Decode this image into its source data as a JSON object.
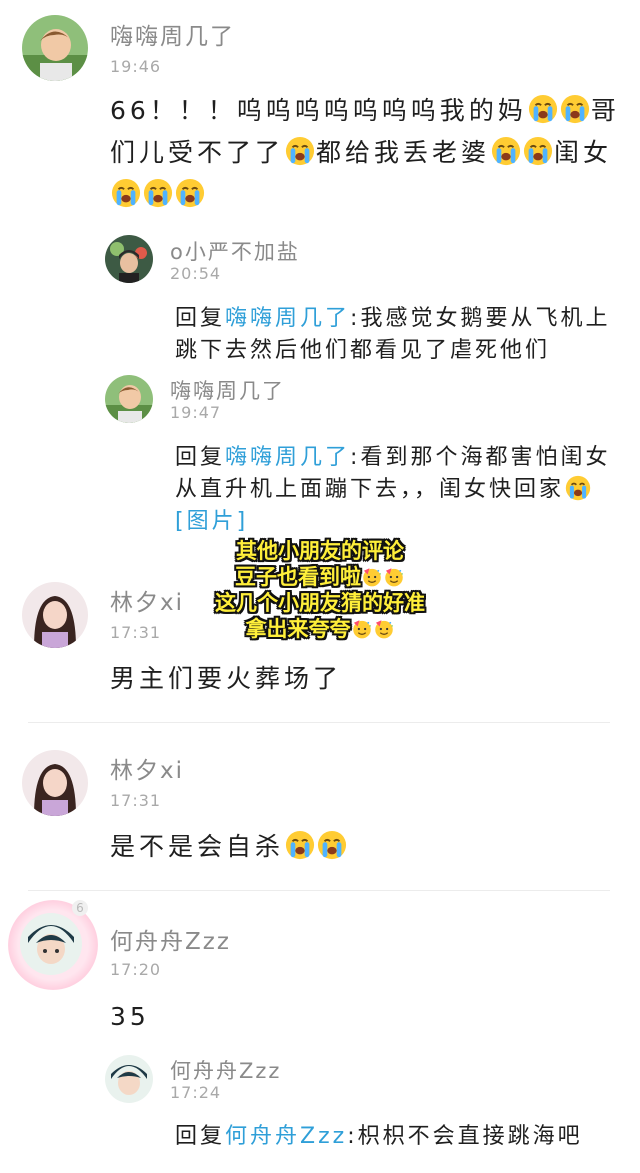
{
  "comments": [
    {
      "user": "嗨嗨周几了",
      "time": "19:46",
      "text_parts": [
        "66！！！呜呜呜呜呜呜呜我的妈",
        "哥们儿受不了了",
        "都给我丢老婆",
        "闺女"
      ],
      "replies": [
        {
          "user": "o小严不加盐",
          "time": "20:54",
          "prefix": "回复",
          "target": "嗨嗨周几了",
          "text": ":我感觉女鹅要从飞机上跳下去然后他们都看见了虐死他们"
        },
        {
          "user": "嗨嗨周几了",
          "time": "19:47",
          "prefix": "回复",
          "target": "嗨嗨周几了",
          "text": ":看到那个海都害怕闺女从直升机上面蹦下去，，闺女快回家",
          "image_tag": "[图片]"
        }
      ]
    },
    {
      "user": "林夕xi",
      "time": "17:31",
      "text": "男主们要火葬场了"
    },
    {
      "user": "林夕xi",
      "time": "17:31",
      "text": "是不是会自杀"
    },
    {
      "user": "何舟舟Zzz",
      "time": "17:20",
      "text": "35",
      "badge": "6",
      "replies": [
        {
          "user": "何舟舟Zzz",
          "time": "17:24",
          "prefix": "回复",
          "target": "何舟舟Zzz",
          "text": ":枳枳不会直接跳海吧"
        }
      ]
    }
  ],
  "overlay_caption": [
    "其他小朋友的评论",
    "豆子也看到啦",
    "这几个小朋友猜的好准",
    "拿出来夸夸"
  ],
  "icons": {
    "crying_emoji": "crying-face-icon",
    "party_emoji": "party-face-icon"
  },
  "colors": {
    "link": "#2f9fd8",
    "caption_fill": "#ffef3a",
    "caption_outline": "#111111"
  }
}
